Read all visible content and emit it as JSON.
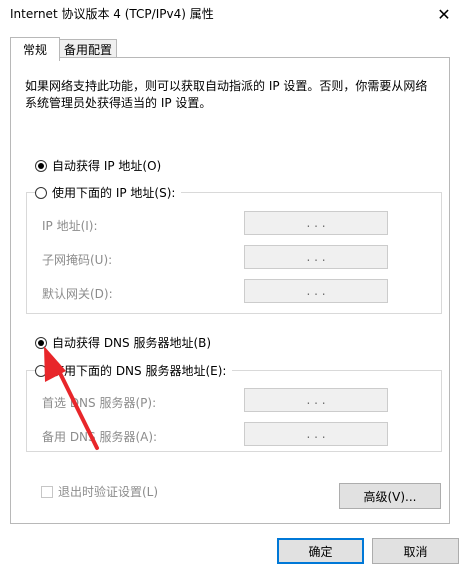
{
  "window": {
    "title": "Internet 协议版本 4 (TCP/IPv4) 属性",
    "close_glyph": "✕"
  },
  "tabs": [
    {
      "label": "常规",
      "active": true
    },
    {
      "label": "备用配置",
      "active": false
    }
  ],
  "description": "如果网络支持此功能，则可以获取自动指派的 IP 设置。否则，你需要从网络系统管理员处获得适当的 IP 设置。",
  "ip_section": {
    "auto_label": "自动获得 IP 地址(O)",
    "auto_checked": true,
    "manual_label": "使用下面的 IP 地址(S):",
    "manual_checked": false,
    "fields": [
      {
        "label": "IP 地址(I):",
        "value": ". . ."
      },
      {
        "label": "子网掩码(U):",
        "value": ". . ."
      },
      {
        "label": "默认网关(D):",
        "value": ". . ."
      }
    ]
  },
  "dns_section": {
    "auto_label": "自动获得 DNS 服务器地址(B)",
    "auto_checked": true,
    "manual_label": "使用下面的 DNS 服务器地址(E):",
    "manual_checked": false,
    "fields": [
      {
        "label": "首选 DNS 服务器(P):",
        "value": ". . ."
      },
      {
        "label": "备用 DNS 服务器(A):",
        "value": ". . ."
      }
    ]
  },
  "validate_label": "退出时验证设置(L)",
  "buttons": {
    "advanced": "高级(V)...",
    "ok": "确定",
    "cancel": "取消"
  },
  "colors": {
    "accent": "#0078d7",
    "annotation_arrow": "#e8262a"
  },
  "icons": {
    "close": "close-icon",
    "annotation": "red-arrow-icon"
  }
}
